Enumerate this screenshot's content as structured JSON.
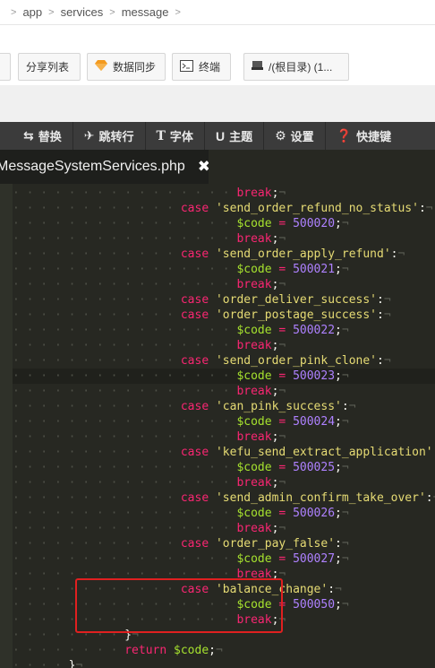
{
  "breadcrumb": [
    "app",
    "services",
    "message"
  ],
  "breadcrumb_sep": ">",
  "toolbar": {
    "share_list": "分享列表",
    "data_sync": "数据同步",
    "terminal": "终端",
    "root_dir": "/(根目录) (1..."
  },
  "menu": {
    "replace": "替换",
    "goto_line": "跳转行",
    "font": "字体",
    "theme": "主题",
    "settings": "设置",
    "shortcuts": "快捷键"
  },
  "tab": {
    "filename": "MessageSystemServices.php",
    "close": "✖"
  },
  "code_lines": [
    {
      "dots": "· · · · · · · · · · · · · · · · ",
      "tokens": [
        [
          "kw",
          "break"
        ],
        [
          "pun",
          ";"
        ],
        [
          "nl",
          "¬"
        ]
      ]
    },
    {
      "dots": "· · · · · · · · · · · · ",
      "tokens": [
        [
          "kw",
          "case"
        ],
        [
          "pun",
          " "
        ],
        [
          "str",
          "'send_order_refund_no_status'"
        ],
        [
          "pun",
          ":"
        ],
        [
          "nl",
          "¬"
        ]
      ]
    },
    {
      "dots": "· · · · · · · · · · · · · · · · ",
      "tokens": [
        [
          "var",
          "$code"
        ],
        [
          "pun",
          " "
        ],
        [
          "op",
          "="
        ],
        [
          "pun",
          " "
        ],
        [
          "num",
          "500020"
        ],
        [
          "pun",
          ";"
        ],
        [
          "nl",
          "¬"
        ]
      ]
    },
    {
      "dots": "· · · · · · · · · · · · · · · · ",
      "tokens": [
        [
          "kw",
          "break"
        ],
        [
          "pun",
          ";"
        ],
        [
          "nl",
          "¬"
        ]
      ]
    },
    {
      "dots": "· · · · · · · · · · · · ",
      "tokens": [
        [
          "kw",
          "case"
        ],
        [
          "pun",
          " "
        ],
        [
          "str",
          "'send_order_apply_refund'"
        ],
        [
          "pun",
          ":"
        ],
        [
          "nl",
          "¬"
        ]
      ]
    },
    {
      "dots": "· · · · · · · · · · · · · · · · ",
      "tokens": [
        [
          "var",
          "$code"
        ],
        [
          "pun",
          " "
        ],
        [
          "op",
          "="
        ],
        [
          "pun",
          " "
        ],
        [
          "num",
          "500021"
        ],
        [
          "pun",
          ";"
        ],
        [
          "nl",
          "¬"
        ]
      ]
    },
    {
      "dots": "· · · · · · · · · · · · · · · · ",
      "tokens": [
        [
          "kw",
          "break"
        ],
        [
          "pun",
          ";"
        ],
        [
          "nl",
          "¬"
        ]
      ]
    },
    {
      "dots": "· · · · · · · · · · · · ",
      "tokens": [
        [
          "kw",
          "case"
        ],
        [
          "pun",
          " "
        ],
        [
          "str",
          "'order_deliver_success'"
        ],
        [
          "pun",
          ":"
        ],
        [
          "nl",
          "¬"
        ]
      ]
    },
    {
      "dots": "· · · · · · · · · · · · ",
      "tokens": [
        [
          "kw",
          "case"
        ],
        [
          "pun",
          " "
        ],
        [
          "str",
          "'order_postage_success'"
        ],
        [
          "pun",
          ":"
        ],
        [
          "nl",
          "¬"
        ]
      ]
    },
    {
      "dots": "· · · · · · · · · · · · · · · · ",
      "tokens": [
        [
          "var",
          "$code"
        ],
        [
          "pun",
          " "
        ],
        [
          "op",
          "="
        ],
        [
          "pun",
          " "
        ],
        [
          "num",
          "500022"
        ],
        [
          "pun",
          ";"
        ],
        [
          "nl",
          "¬"
        ]
      ]
    },
    {
      "dots": "· · · · · · · · · · · · · · · · ",
      "tokens": [
        [
          "kw",
          "break"
        ],
        [
          "pun",
          ";"
        ],
        [
          "nl",
          "¬"
        ]
      ]
    },
    {
      "dots": "· · · · · · · · · · · · ",
      "tokens": [
        [
          "kw",
          "case"
        ],
        [
          "pun",
          " "
        ],
        [
          "str",
          "'send_order_pink_clone'"
        ],
        [
          "pun",
          ":"
        ],
        [
          "nl",
          "¬"
        ]
      ]
    },
    {
      "dots": "· · · · · · · · · · · · · · · · ",
      "tokens": [
        [
          "var",
          "$code"
        ],
        [
          "pun",
          " "
        ],
        [
          "op",
          "="
        ],
        [
          "pun",
          " "
        ],
        [
          "num",
          "500023"
        ],
        [
          "pun",
          ";"
        ],
        [
          "nl",
          "¬"
        ]
      ]
    },
    {
      "dots": "· · · · · · · · · · · · · · · · ",
      "tokens": [
        [
          "kw",
          "break"
        ],
        [
          "pun",
          ";"
        ],
        [
          "nl",
          "¬"
        ]
      ]
    },
    {
      "dots": "· · · · · · · · · · · · ",
      "tokens": [
        [
          "kw",
          "case"
        ],
        [
          "pun",
          " "
        ],
        [
          "str",
          "'can_pink_success'"
        ],
        [
          "pun",
          ":"
        ],
        [
          "nl",
          "¬"
        ]
      ]
    },
    {
      "dots": "· · · · · · · · · · · · · · · · ",
      "tokens": [
        [
          "var",
          "$code"
        ],
        [
          "pun",
          " "
        ],
        [
          "op",
          "="
        ],
        [
          "pun",
          " "
        ],
        [
          "num",
          "500024"
        ],
        [
          "pun",
          ";"
        ],
        [
          "nl",
          "¬"
        ]
      ]
    },
    {
      "dots": "· · · · · · · · · · · · · · · · ",
      "tokens": [
        [
          "kw",
          "break"
        ],
        [
          "pun",
          ";"
        ],
        [
          "nl",
          "¬"
        ]
      ]
    },
    {
      "dots": "· · · · · · · · · · · · ",
      "tokens": [
        [
          "kw",
          "case"
        ],
        [
          "pun",
          " "
        ],
        [
          "str",
          "'kefu_send_extract_application'"
        ],
        [
          "pun",
          ":"
        ],
        [
          "nl",
          "¬"
        ]
      ]
    },
    {
      "dots": "· · · · · · · · · · · · · · · · ",
      "tokens": [
        [
          "var",
          "$code"
        ],
        [
          "pun",
          " "
        ],
        [
          "op",
          "="
        ],
        [
          "pun",
          " "
        ],
        [
          "num",
          "500025"
        ],
        [
          "pun",
          ";"
        ],
        [
          "nl",
          "¬"
        ]
      ]
    },
    {
      "dots": "· · · · · · · · · · · · · · · · ",
      "tokens": [
        [
          "kw",
          "break"
        ],
        [
          "pun",
          ";"
        ],
        [
          "nl",
          "¬"
        ]
      ]
    },
    {
      "dots": "· · · · · · · · · · · · ",
      "tokens": [
        [
          "kw",
          "case"
        ],
        [
          "pun",
          " "
        ],
        [
          "str",
          "'send_admin_confirm_take_over'"
        ],
        [
          "pun",
          ":"
        ],
        [
          "nl",
          "¬"
        ]
      ]
    },
    {
      "dots": "· · · · · · · · · · · · · · · · ",
      "tokens": [
        [
          "var",
          "$code"
        ],
        [
          "pun",
          " "
        ],
        [
          "op",
          "="
        ],
        [
          "pun",
          " "
        ],
        [
          "num",
          "500026"
        ],
        [
          "pun",
          ";"
        ],
        [
          "nl",
          "¬"
        ]
      ]
    },
    {
      "dots": "· · · · · · · · · · · · · · · · ",
      "tokens": [
        [
          "kw",
          "break"
        ],
        [
          "pun",
          ";"
        ],
        [
          "nl",
          "¬"
        ]
      ]
    },
    {
      "dots": "· · · · · · · · · · · · ",
      "tokens": [
        [
          "kw",
          "case"
        ],
        [
          "pun",
          " "
        ],
        [
          "str",
          "'order_pay_false'"
        ],
        [
          "pun",
          ":"
        ],
        [
          "nl",
          "¬"
        ]
      ]
    },
    {
      "dots": "· · · · · · · · · · · · · · · · ",
      "tokens": [
        [
          "var",
          "$code"
        ],
        [
          "pun",
          " "
        ],
        [
          "op",
          "="
        ],
        [
          "pun",
          " "
        ],
        [
          "num",
          "500027"
        ],
        [
          "pun",
          ";"
        ],
        [
          "nl",
          "¬"
        ]
      ]
    },
    {
      "dots": "· · · · · · · · · · · · · · · · ",
      "tokens": [
        [
          "kw",
          "break"
        ],
        [
          "pun",
          ";"
        ],
        [
          "nl",
          "¬"
        ]
      ]
    },
    {
      "dots": "· · · · · · · · · · · · ",
      "tokens": [
        [
          "kw",
          "case"
        ],
        [
          "pun",
          " "
        ],
        [
          "str",
          "'balance_change'"
        ],
        [
          "pun",
          ":"
        ],
        [
          "nl",
          "¬"
        ]
      ]
    },
    {
      "dots": "· · · · · · · · · · · · · · · · ",
      "tokens": [
        [
          "var",
          "$code"
        ],
        [
          "pun",
          " "
        ],
        [
          "op",
          "="
        ],
        [
          "pun",
          " "
        ],
        [
          "num",
          "500050"
        ],
        [
          "pun",
          ";"
        ],
        [
          "nl",
          "¬"
        ]
      ]
    },
    {
      "dots": "· · · · · · · · · · · · · · · · ",
      "tokens": [
        [
          "kw",
          "break"
        ],
        [
          "pun",
          ";"
        ],
        [
          "nl",
          "¬"
        ]
      ]
    },
    {
      "dots": "· · · · · · · · ",
      "tokens": [
        [
          "pun",
          "}"
        ],
        [
          "nl",
          "¬"
        ]
      ]
    },
    {
      "dots": "· · · · · · · · ",
      "tokens": [
        [
          "kw",
          "return"
        ],
        [
          "pun",
          " "
        ],
        [
          "var",
          "$code"
        ],
        [
          "pun",
          ";"
        ],
        [
          "nl",
          "¬"
        ]
      ]
    },
    {
      "dots": "· · · · ",
      "tokens": [
        [
          "pun",
          "}"
        ],
        [
          "nl",
          "¬"
        ]
      ]
    }
  ],
  "highlight_box_color": "#e02020",
  "colors": {
    "editor_bg": "#272822",
    "keyword": "#f92672",
    "string": "#e6db74",
    "variable": "#a6e22e",
    "number": "#ae81ff"
  }
}
